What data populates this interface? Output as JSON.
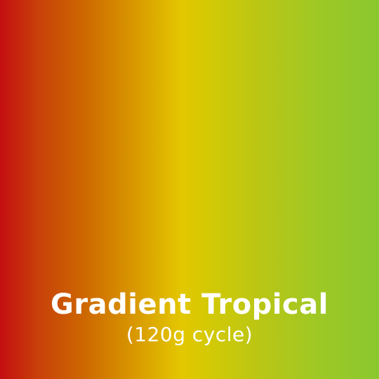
{
  "swatch": {
    "name": "Gradient Tropical",
    "detail": "(120g cycle)",
    "colors": [
      "#c40e10",
      "#cd6700",
      "#e3c800",
      "#8ac82f"
    ]
  }
}
